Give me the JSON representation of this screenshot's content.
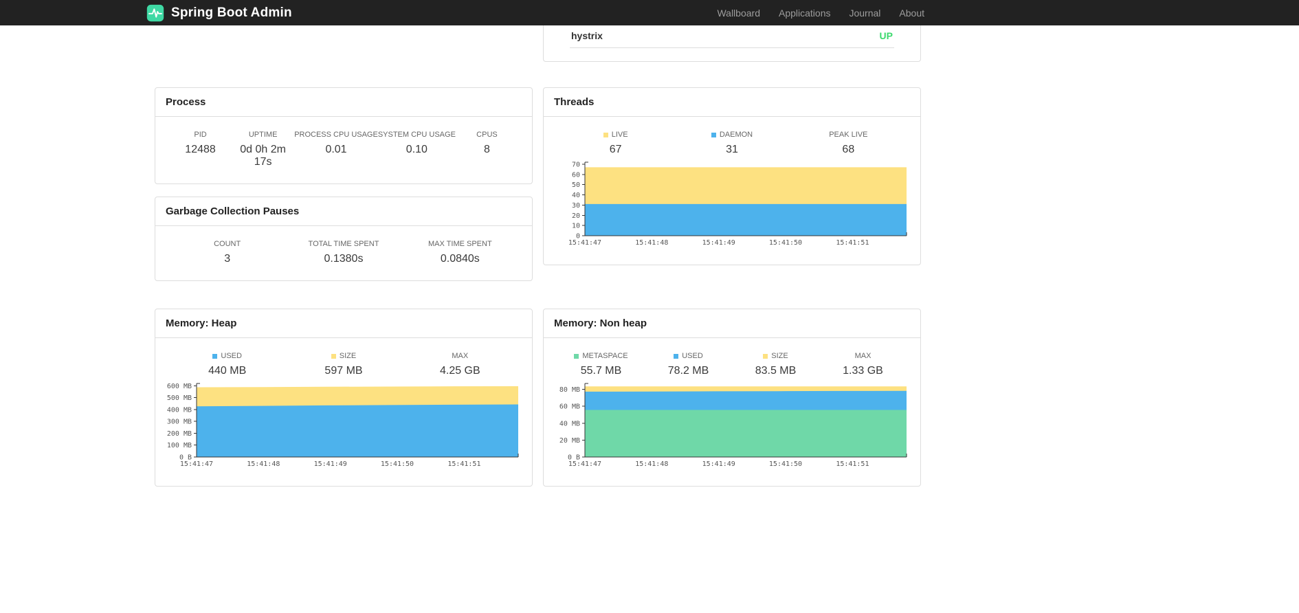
{
  "navbar": {
    "brand": "Spring Boot Admin",
    "items": [
      "Wallboard",
      "Applications",
      "Journal",
      "About"
    ]
  },
  "application_card": {
    "name": "hystrix",
    "status": "UP"
  },
  "colors": {
    "status_up": "#3dd96e",
    "logo_teal": "#3fd9a4",
    "area_yellow": "#fde181",
    "area_blue": "#4db2ec",
    "area_green": "#6fd8a8"
  },
  "panels": {
    "process": {
      "title": "Process",
      "metrics": [
        {
          "label": "PID",
          "value": "12488"
        },
        {
          "label": "UPTIME",
          "value": "0d 0h 2m 17s"
        },
        {
          "label": "PROCESS CPU USAGE",
          "value": "0.01"
        },
        {
          "label": "SYSTEM CPU USAGE",
          "value": "0.10"
        },
        {
          "label": "CPUS",
          "value": "8"
        }
      ]
    },
    "gc": {
      "title": "Garbage Collection Pauses",
      "metrics": [
        {
          "label": "COUNT",
          "value": "3"
        },
        {
          "label": "TOTAL TIME SPENT",
          "value": "0.1380s"
        },
        {
          "label": "MAX TIME SPENT",
          "value": "0.0840s"
        }
      ]
    },
    "threads": {
      "title": "Threads",
      "metrics": [
        {
          "label": "LIVE",
          "value": "67",
          "swatch": "#fde181"
        },
        {
          "label": "DAEMON",
          "value": "31",
          "swatch": "#4db2ec"
        },
        {
          "label": "PEAK LIVE",
          "value": "68"
        }
      ]
    },
    "heap": {
      "title": "Memory: Heap",
      "metrics": [
        {
          "label": "USED",
          "value": "440 MB",
          "swatch": "#4db2ec"
        },
        {
          "label": "SIZE",
          "value": "597 MB",
          "swatch": "#fde181"
        },
        {
          "label": "MAX",
          "value": "4.25 GB"
        }
      ]
    },
    "nonheap": {
      "title": "Memory: Non heap",
      "metrics": [
        {
          "label": "METASPACE",
          "value": "55.7 MB",
          "swatch": "#6fd8a8"
        },
        {
          "label": "USED",
          "value": "78.2 MB",
          "swatch": "#4db2ec"
        },
        {
          "label": "SIZE",
          "value": "83.5 MB",
          "swatch": "#fde181"
        },
        {
          "label": "MAX",
          "value": "1.33 GB"
        }
      ]
    }
  },
  "chart_data": [
    {
      "id": "threads",
      "type": "area",
      "title": "Threads",
      "x": [
        "15:41:47",
        "15:41:48",
        "15:41:49",
        "15:41:50",
        "15:41:51"
      ],
      "xtick_step": 0.208,
      "ylim": [
        0,
        72
      ],
      "yticks": [
        {
          "v": 0,
          "label": "0"
        },
        {
          "v": 10,
          "label": "10"
        },
        {
          "v": 20,
          "label": "20"
        },
        {
          "v": 30,
          "label": "30"
        },
        {
          "v": 40,
          "label": "40"
        },
        {
          "v": 50,
          "label": "50"
        },
        {
          "v": 60,
          "label": "60"
        },
        {
          "v": 70,
          "label": "70"
        }
      ],
      "series": [
        {
          "name": "LIVE",
          "color": "#fde181",
          "values": [
            67,
            67,
            67,
            67,
            67,
            67
          ]
        },
        {
          "name": "DAEMON",
          "color": "#4db2ec",
          "values": [
            31,
            31,
            31,
            31,
            31,
            31
          ]
        }
      ],
      "legend": {
        "LIVE": "67",
        "DAEMON": "31",
        "PEAK LIVE": "68"
      }
    },
    {
      "id": "heap",
      "type": "area",
      "title": "Memory: Heap",
      "unit": "MB",
      "x": [
        "15:41:47",
        "15:41:48",
        "15:41:49",
        "15:41:50",
        "15:41:51"
      ],
      "xtick_step": 0.208,
      "ylim": [
        0,
        620
      ],
      "yticks": [
        {
          "v": 0,
          "label": "0 B"
        },
        {
          "v": 100,
          "label": "100 MB"
        },
        {
          "v": 200,
          "label": "200 MB"
        },
        {
          "v": 300,
          "label": "300 MB"
        },
        {
          "v": 400,
          "label": "400 MB"
        },
        {
          "v": 500,
          "label": "500 MB"
        },
        {
          "v": 600,
          "label": "600 MB"
        }
      ],
      "series": [
        {
          "name": "SIZE",
          "color": "#fde181",
          "values": [
            588,
            590,
            592,
            594,
            596,
            597
          ]
        },
        {
          "name": "USED",
          "color": "#4db2ec",
          "values": [
            427,
            431,
            435,
            438,
            441,
            443
          ]
        }
      ],
      "legend": {
        "USED": "440 MB",
        "SIZE": "597 MB",
        "MAX": "4.25 GB"
      }
    },
    {
      "id": "nonheap",
      "type": "area",
      "title": "Memory: Non heap",
      "unit": "MB",
      "x": [
        "15:41:47",
        "15:41:48",
        "15:41:49",
        "15:41:50",
        "15:41:51"
      ],
      "xtick_step": 0.208,
      "ylim": [
        0,
        87
      ],
      "yticks": [
        {
          "v": 0,
          "label": "0 B"
        },
        {
          "v": 20,
          "label": "20 MB"
        },
        {
          "v": 40,
          "label": "40 MB"
        },
        {
          "v": 60,
          "label": "60 MB"
        },
        {
          "v": 80,
          "label": "80 MB"
        }
      ],
      "series": [
        {
          "name": "SIZE",
          "color": "#fde181",
          "values": [
            83.5,
            83.5,
            83.5,
            83.5,
            83.5,
            83.5
          ]
        },
        {
          "name": "USED",
          "color": "#4db2ec",
          "values": [
            77.3,
            77.5,
            77.7,
            77.9,
            78.1,
            78.2
          ]
        },
        {
          "name": "METASPACE",
          "color": "#6fd8a8",
          "values": [
            55.7,
            55.7,
            55.7,
            55.7,
            55.7,
            55.7
          ]
        }
      ],
      "legend": {
        "METASPACE": "55.7 MB",
        "USED": "78.2 MB",
        "SIZE": "83.5 MB",
        "MAX": "1.33 GB"
      }
    }
  ]
}
